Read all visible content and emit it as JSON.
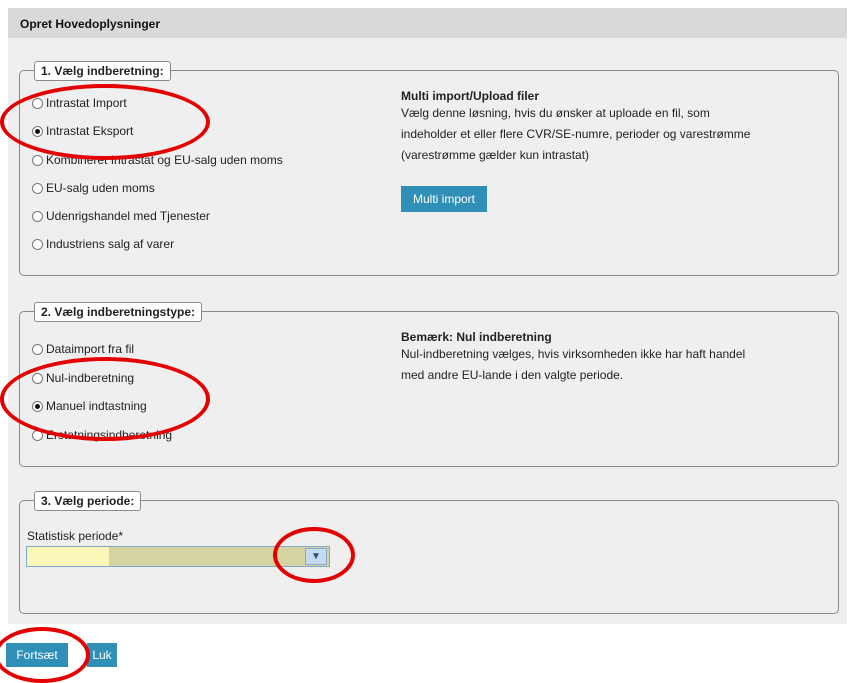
{
  "header": {
    "title": "Opret Hovedoplysninger"
  },
  "section1": {
    "legend": "1. Vælg indberetning:",
    "options": [
      {
        "label": "Intrastat Import",
        "checked": false
      },
      {
        "label": "Intrastat Eksport",
        "checked": true
      },
      {
        "label": "Kombineret Intrastat og EU-salg uden moms",
        "checked": false
      },
      {
        "label": "EU-salg uden moms",
        "checked": false
      },
      {
        "label": "Udenrigshandel med Tjenester",
        "checked": false
      },
      {
        "label": "Industriens salg af varer",
        "checked": false
      }
    ],
    "info_title": "Multi import/Upload filer",
    "info_lines": [
      "Vælg denne løsning, hvis du ønsker at uploade en fil, som",
      "indeholder et eller flere CVR/SE-numre, perioder og varestrømme",
      "(varestrømme gælder kun intrastat)"
    ],
    "button_label": "Multi import"
  },
  "section2": {
    "legend": "2. Vælg indberetningstype:",
    "options": [
      {
        "label": "Dataimport fra fil",
        "checked": false
      },
      {
        "label": "Nul-indberetning",
        "checked": false
      },
      {
        "label": "Manuel indtastning",
        "checked": true
      },
      {
        "label": "Erstatningsindberetning",
        "checked": false
      }
    ],
    "info_title": "Bemærk: Nul indberetning",
    "info_lines": [
      "Nul-indberetning vælges, hvis virksomheden ikke har haft handel",
      "med andre EU-lande i den valgte periode."
    ]
  },
  "section3": {
    "legend": "3. Vælg periode:",
    "field_label": "Statistisk periode*",
    "select_value": ""
  },
  "footer": {
    "continue_label": "Fortsæt",
    "close_label": "Luk"
  },
  "colors": {
    "button": "#2f8fb7",
    "annotation": "#e40000"
  }
}
